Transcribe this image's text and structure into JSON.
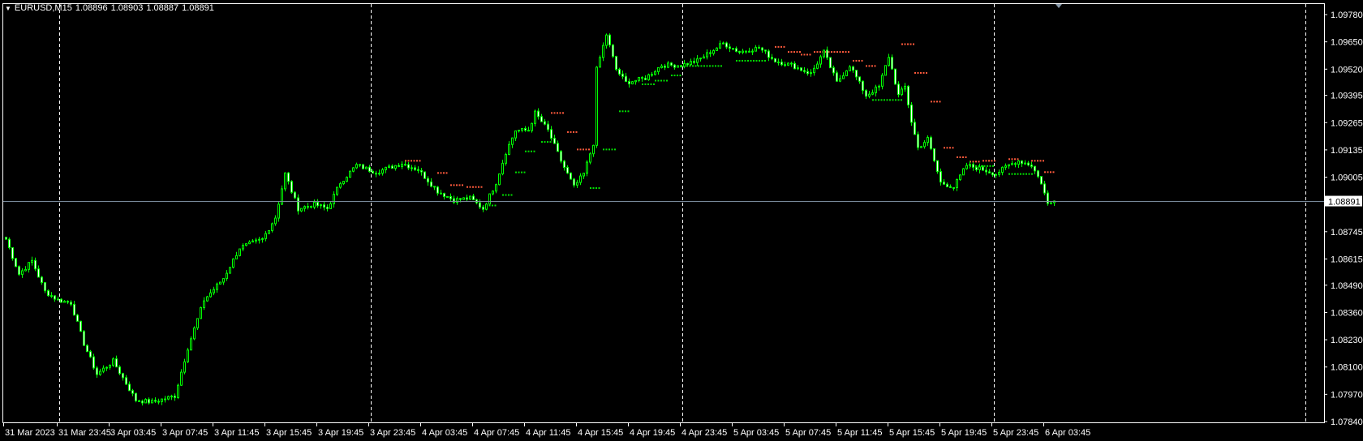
{
  "header": {
    "symbol": "EURUSD,M15",
    "open": "1.08896",
    "high": "1.08903",
    "low": "1.08887",
    "close": "1.08891"
  },
  "colors": {
    "background": "#000000",
    "candle": "#00ff00",
    "bull_body": "#000000",
    "bear_body": "#ffffff",
    "grid": "#ffffff",
    "bid_line": "#778899",
    "dot_red": "#ff5a3c",
    "dot_green": "#00e000"
  },
  "chart_data": {
    "type": "candlestick",
    "title": "EURUSD,M15",
    "ylim": [
      1.0784,
      1.0978
    ],
    "current_price": 1.08891,
    "current_price_label": "1.08891",
    "y_ticks": [
      "1.09780",
      "1.09650",
      "1.09520",
      "1.09395",
      "1.09265",
      "1.09135",
      "1.09005",
      "1.08745",
      "1.08615",
      "1.08490",
      "1.08360",
      "1.08230",
      "1.08100",
      "1.07970",
      "1.07840"
    ],
    "x_ticks": [
      "31 Mar 2023",
      "31 Mar 23:45",
      "3 Apr 03:45",
      "3 Apr 07:45",
      "3 Apr 11:45",
      "3 Apr 15:45",
      "3 Apr 19:45",
      "3 Apr 23:45",
      "4 Apr 03:45",
      "4 Apr 07:45",
      "4 Apr 11:45",
      "4 Apr 15:45",
      "4 Apr 19:45",
      "4 Apr 23:45",
      "5 Apr 03:45",
      "5 Apr 07:45",
      "5 Apr 11:45",
      "5 Apr 15:45",
      "5 Apr 19:45",
      "5 Apr 23:45",
      "6 Apr 03:45"
    ],
    "bars_per_tick": 16,
    "bar_count": 324,
    "close_path": [
      [
        0,
        1.08709
      ],
      [
        4,
        1.08543
      ],
      [
        8,
        1.08606
      ],
      [
        12,
        1.0846
      ],
      [
        16,
        1.08419
      ],
      [
        20,
        1.08406
      ],
      [
        24,
        1.08211
      ],
      [
        28,
        1.08066
      ],
      [
        33,
        1.08128
      ],
      [
        40,
        1.07942
      ],
      [
        45,
        1.07933
      ],
      [
        52,
        1.07962
      ],
      [
        56,
        1.08191
      ],
      [
        61,
        1.08419
      ],
      [
        67,
        1.08523
      ],
      [
        72,
        1.08668
      ],
      [
        79,
        1.08709
      ],
      [
        83,
        1.08813
      ],
      [
        86,
        1.09021
      ],
      [
        90,
        1.08855
      ],
      [
        95,
        1.08875
      ],
      [
        99,
        1.08855
      ],
      [
        103,
        1.08979
      ],
      [
        108,
        1.09062
      ],
      [
        114,
        1.09029
      ],
      [
        122,
        1.09071
      ],
      [
        127,
        1.09041
      ],
      [
        133,
        1.08938
      ],
      [
        138,
        1.08896
      ],
      [
        143,
        1.08905
      ],
      [
        147,
        1.08855
      ],
      [
        151,
        1.08979
      ],
      [
        154,
        1.09124
      ],
      [
        157,
        1.09228
      ],
      [
        161,
        1.09228
      ],
      [
        163,
        1.09311
      ],
      [
        167,
        1.09228
      ],
      [
        171,
        1.09083
      ],
      [
        175,
        1.08958
      ],
      [
        178,
        1.09021
      ],
      [
        181,
        1.09166
      ],
      [
        182,
        1.09519
      ],
      [
        185,
        1.09685
      ],
      [
        188,
        1.09519
      ],
      [
        191,
        1.09456
      ],
      [
        197,
        1.09477
      ],
      [
        202,
        1.09539
      ],
      [
        208,
        1.09539
      ],
      [
        213,
        1.0956
      ],
      [
        221,
        1.09643
      ],
      [
        226,
        1.09602
      ],
      [
        232,
        1.09622
      ],
      [
        237,
        1.0956
      ],
      [
        242,
        1.09539
      ],
      [
        248,
        1.09498
      ],
      [
        252,
        1.09602
      ],
      [
        256,
        1.09456
      ],
      [
        260,
        1.09539
      ],
      [
        265,
        1.09394
      ],
      [
        269,
        1.09436
      ],
      [
        272,
        1.09581
      ],
      [
        275,
        1.09394
      ],
      [
        277,
        1.09436
      ],
      [
        279,
        1.0927
      ],
      [
        281,
        1.09145
      ],
      [
        284,
        1.09187
      ],
      [
        288,
        1.08979
      ],
      [
        292,
        1.08958
      ],
      [
        296,
        1.09062
      ],
      [
        301,
        1.09041
      ],
      [
        305,
        1.09021
      ],
      [
        309,
        1.09062
      ],
      [
        312,
        1.09083
      ],
      [
        316,
        1.09062
      ],
      [
        319,
        1.08979
      ],
      [
        321,
        1.08876
      ],
      [
        323,
        1.08891
      ]
    ],
    "indicator_levels": [
      [
        123,
        128,
        1.09083,
        "red"
      ],
      [
        133,
        136,
        1.09025,
        "red"
      ],
      [
        137,
        141,
        1.08967,
        "red"
      ],
      [
        142,
        147,
        1.08958,
        "red"
      ],
      [
        168,
        172,
        1.09311,
        "red"
      ],
      [
        173,
        176,
        1.0922,
        "red"
      ],
      [
        176,
        180,
        1.09137,
        "red"
      ],
      [
        237,
        240,
        1.09626,
        "red"
      ],
      [
        241,
        245,
        1.09602,
        "red"
      ],
      [
        245,
        248,
        1.09589,
        "red"
      ],
      [
        249,
        260,
        1.09602,
        "red"
      ],
      [
        261,
        264,
        1.0956,
        "red"
      ],
      [
        265,
        268,
        1.09535,
        "red"
      ],
      [
        276,
        280,
        1.09639,
        "red"
      ],
      [
        280,
        284,
        1.09502,
        "red"
      ],
      [
        285,
        288,
        1.09365,
        "red"
      ],
      [
        289,
        292,
        1.09145,
        "red"
      ],
      [
        293,
        296,
        1.091,
        "red"
      ],
      [
        297,
        300,
        1.09079,
        "red"
      ],
      [
        301,
        305,
        1.09083,
        "red"
      ],
      [
        309,
        312,
        1.09091,
        "red"
      ],
      [
        316,
        320,
        1.09083,
        "red"
      ],
      [
        320,
        323,
        1.09029,
        "red"
      ],
      [
        148,
        151,
        1.0887,
        "green"
      ],
      [
        153,
        156,
        1.0892,
        "green"
      ],
      [
        157,
        160,
        1.09028,
        "green"
      ],
      [
        160,
        163,
        1.09128,
        "green"
      ],
      [
        165,
        168,
        1.09173,
        "green"
      ],
      [
        180,
        183,
        1.08953,
        "green"
      ],
      [
        184,
        188,
        1.09137,
        "green"
      ],
      [
        189,
        192,
        1.09319,
        "green"
      ],
      [
        196,
        200,
        1.09448,
        "green"
      ],
      [
        200,
        204,
        1.09465,
        "green"
      ],
      [
        205,
        208,
        1.0949,
        "green"
      ],
      [
        208,
        221,
        1.09535,
        "green"
      ],
      [
        225,
        234,
        1.0956,
        "green"
      ],
      [
        267,
        276,
        1.09373,
        "green"
      ],
      [
        297,
        304,
        1.09058,
        "green"
      ],
      [
        309,
        316,
        1.0902,
        "green"
      ]
    ]
  }
}
